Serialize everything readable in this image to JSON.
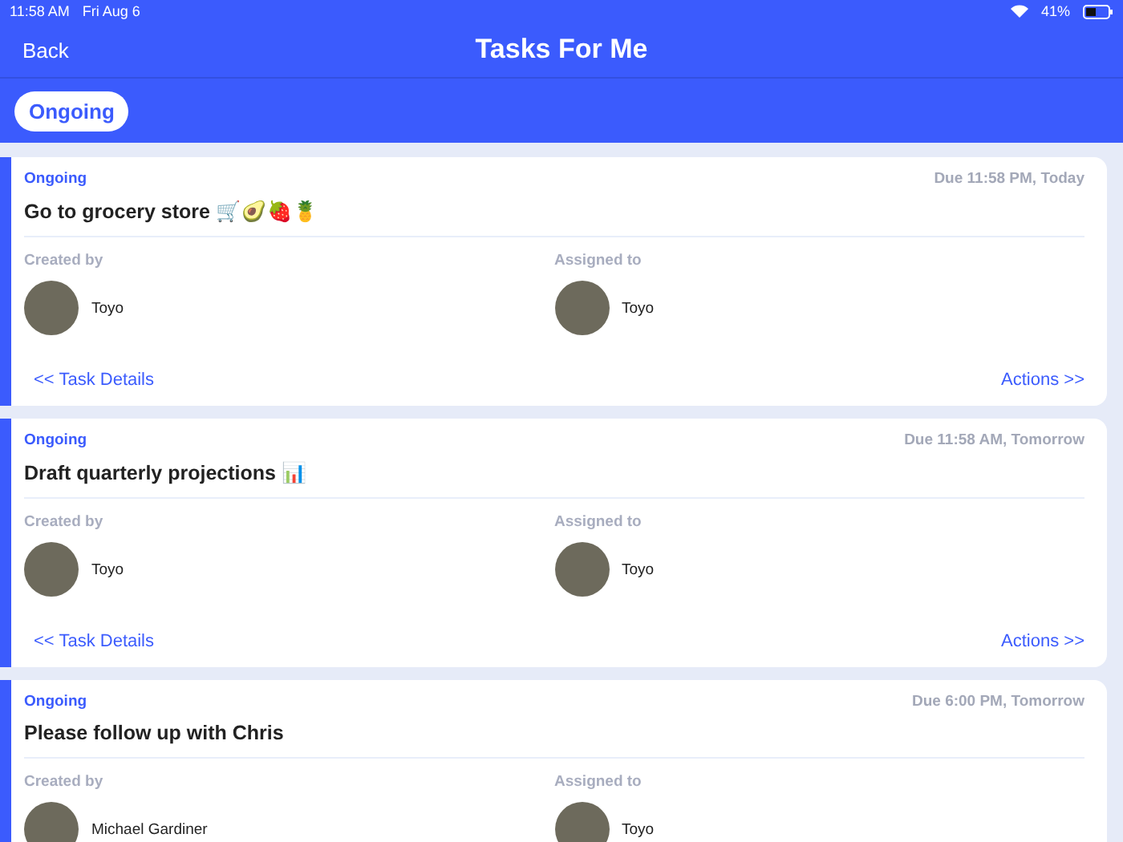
{
  "status_bar": {
    "time": "11:58 AM",
    "date": "Fri Aug 6",
    "battery": "41%"
  },
  "nav": {
    "back": "Back",
    "title": "Tasks For Me"
  },
  "filters": [
    {
      "label": "Ongoing",
      "selected": true
    }
  ],
  "tasks": [
    {
      "status": "Ongoing",
      "due": "Due 11:58 PM, Today",
      "title": "Go to grocery store 🛒🥑🍓🍍",
      "created_label": "Created by",
      "created_by": "Toyo",
      "assigned_label": "Assigned to",
      "assigned_to": "Toyo",
      "details_link": "<< Task Details",
      "actions_link": "Actions >>"
    },
    {
      "status": "Ongoing",
      "due": "Due 11:58 AM, Tomorrow",
      "title": "Draft quarterly projections 📊",
      "created_label": "Created by",
      "created_by": "Toyo",
      "assigned_label": "Assigned to",
      "assigned_to": "Toyo",
      "details_link": "<< Task Details",
      "actions_link": "Actions >>"
    },
    {
      "status": "Ongoing",
      "due": "Due 6:00 PM, Tomorrow",
      "title": "Please follow up with Chris",
      "created_label": "Created by",
      "created_by": "Michael Gardiner",
      "assigned_label": "Assigned to",
      "assigned_to": "Toyo"
    }
  ]
}
